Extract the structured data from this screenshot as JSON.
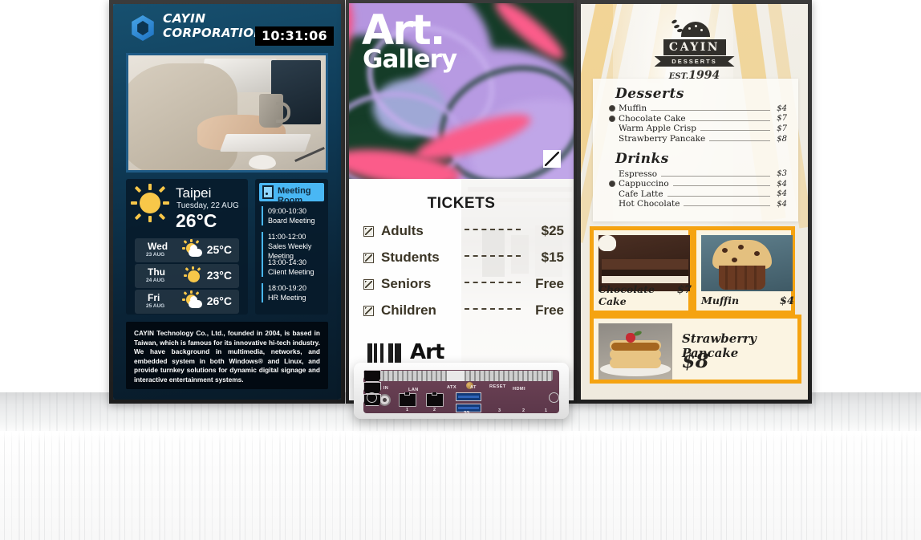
{
  "screen1": {
    "brand_line1": "CAYIN",
    "brand_line2": "CORPORATION",
    "clock": "10:31:06",
    "weather": {
      "city": "Taipei",
      "date": "Tuesday, 22 AUG",
      "temp": "26°C",
      "forecast": [
        {
          "day": "Wed",
          "date": "23 AUG",
          "temp": "25°C",
          "icon": "partly-cloudy-icon"
        },
        {
          "day": "Thu",
          "date": "24 AUG",
          "temp": "23°C",
          "icon": "sun-icon"
        },
        {
          "day": "Fri",
          "date": "25 AUG",
          "temp": "26°C",
          "icon": "partly-cloudy-icon"
        }
      ]
    },
    "meeting": {
      "title": "Meeting Room",
      "icon": "door-icon",
      "events": [
        {
          "time": "09:00-10:30",
          "name": "Board Meeting"
        },
        {
          "time": "11:00-12:00",
          "name": "Sales Weekly Meeting"
        },
        {
          "time": "13:00-14:30",
          "name": "Client Meeting"
        },
        {
          "time": "18:00-19:20",
          "name": "HR Meeting"
        }
      ]
    },
    "about": "CAYIN Technology Co., Ltd., founded in 2004, is based in Taiwan, which is famous for its innovative hi-tech industry. We have background in multimedia, networks, and embedded system in both Windows® and Linux, and provide turnkey solutions for dynamic digital signage and interactive entertainment systems."
  },
  "screen2": {
    "title_line1": "Art.",
    "title_line2": "Gallery",
    "tickets_heading": "TICKETS",
    "tickets": [
      {
        "label": "Adults",
        "price": "$25"
      },
      {
        "label": "Students",
        "price": "$15"
      },
      {
        "label": "Seniors",
        "price": "Free"
      },
      {
        "label": "Children",
        "price": "Free"
      }
    ]
  },
  "screen3": {
    "logo_name": "CAYIN",
    "logo_sub": "DESSERTS",
    "logo_est_prefix": "EST.",
    "logo_est_year": "1994",
    "menu": [
      {
        "heading": "Desserts",
        "items": [
          {
            "name": "Muffin",
            "price": "$4",
            "bullet": true
          },
          {
            "name": "Chocolate Cake",
            "price": "$7",
            "bullet": true
          },
          {
            "name": "Warm Apple Crisp",
            "price": "$7",
            "bullet": false
          },
          {
            "name": "Strawberry Pancake",
            "price": "$8",
            "bullet": false
          }
        ]
      },
      {
        "heading": "Drinks",
        "items": [
          {
            "name": "Espresso",
            "price": "$3",
            "bullet": false
          },
          {
            "name": "Cappuccino",
            "price": "$4",
            "bullet": true
          },
          {
            "name": "Cafe Latte",
            "price": "$4",
            "bullet": false
          },
          {
            "name": "Hot Chocolate",
            "price": "$4",
            "bullet": false
          }
        ]
      }
    ],
    "cards": [
      {
        "name": "Chocolate Cake",
        "price": "$7"
      },
      {
        "name": "Muffin",
        "price": "$4"
      },
      {
        "name": "Strawberry Pancake",
        "price": "$8"
      }
    ]
  },
  "device": {
    "labels": {
      "dc_in": "DC IN",
      "lan": "LAN",
      "atx": "ATX",
      "at": "AT",
      "reset": "RESET",
      "hdmi": "HDMI",
      "usb": "SS",
      "lan1": "1",
      "lan2": "2",
      "hdmi3": "3",
      "hdmi2": "2",
      "hdmi1": "1"
    },
    "behind_text": "Art"
  }
}
